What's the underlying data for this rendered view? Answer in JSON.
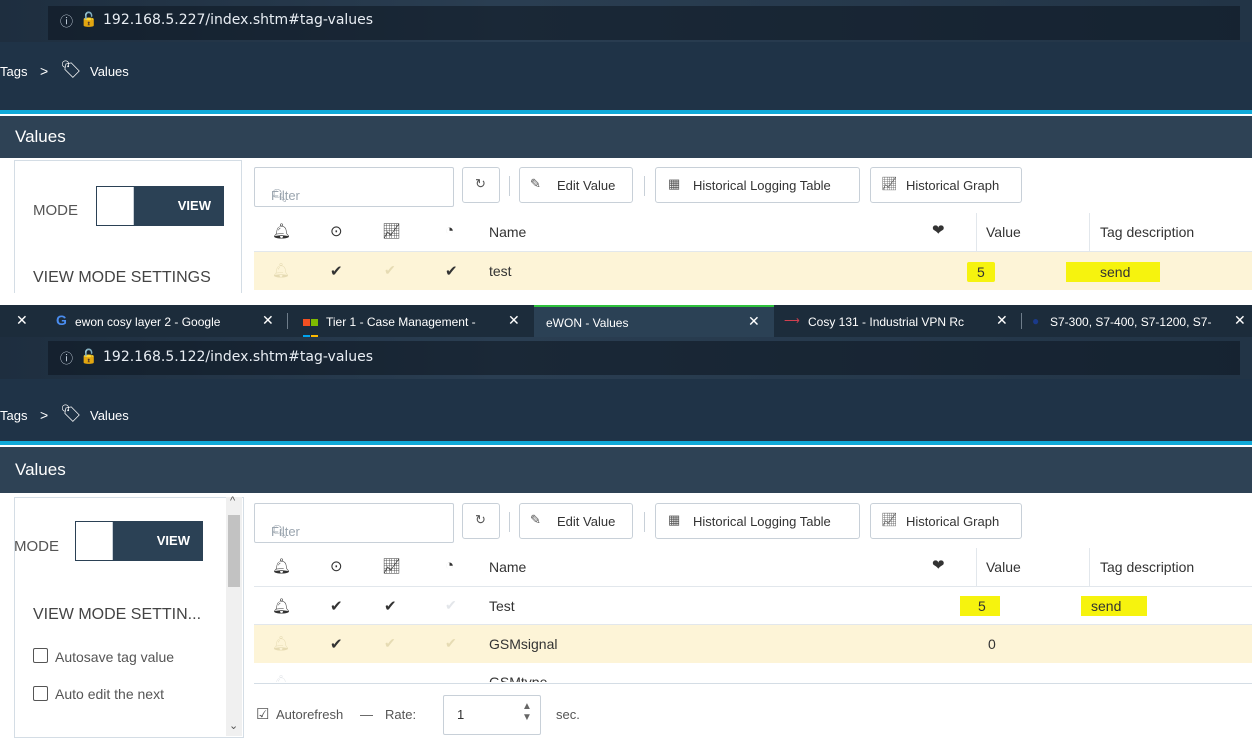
{
  "top": {
    "url": "192.168.5.227/index.shtm#tag-values",
    "breadcrumb": {
      "parent": "Tags",
      "separator": ">",
      "current": "Values"
    },
    "section_title": "Values",
    "mode_label": "MODE",
    "mode_toggle": "VIEW",
    "view_mode_settings": "VIEW MODE SETTINGS",
    "filter_placeholder": "Filter",
    "buttons": {
      "edit_value": "Edit Value",
      "historical_logging_table": "Historical Logging Table",
      "historical_graph": "Historical Graph"
    },
    "columns": {
      "name": "Name",
      "value": "Value",
      "tag_description": "Tag description"
    },
    "rows": [
      {
        "name": "test",
        "value": "5",
        "description": "send"
      }
    ]
  },
  "tabs": [
    {
      "label": "ewon cosy layer 2 - Google",
      "icon": "google-icon"
    },
    {
      "label": "Tier 1 - Case Management -",
      "icon": "windows-icon"
    },
    {
      "label": "eWON - Values",
      "icon": "none",
      "active": true
    },
    {
      "label": "Cosy 131 - Industrial VPN Rc",
      "icon": "ewon-icon"
    },
    {
      "label": "S7-300, S7-400, S7-1200, S7-",
      "icon": "siemens-icon"
    }
  ],
  "bottom": {
    "url": "192.168.5.122/index.shtm#tag-values",
    "breadcrumb": {
      "parent": "Tags",
      "separator": ">",
      "current": "Values"
    },
    "section_title": "Values",
    "mode_label": "MODE",
    "mode_toggle": "VIEW",
    "view_mode_settings": "VIEW MODE SETTIN...",
    "options": [
      "Autosave tag value",
      "Auto edit the next"
    ],
    "filter_placeholder": "Filter",
    "buttons": {
      "edit_value": "Edit Value",
      "historical_logging_table": "Historical Logging Table",
      "historical_graph": "Historical Graph"
    },
    "columns": {
      "name": "Name",
      "value": "Value",
      "tag_description": "Tag description"
    },
    "rows": [
      {
        "name": "Test",
        "value": "5",
        "description": "send"
      },
      {
        "name": "GSMsignal",
        "value": "0",
        "description": ""
      },
      {
        "name": "GSMtype",
        "value": "",
        "description": ""
      }
    ],
    "footer": {
      "autorefresh": "Autorefresh",
      "dash": "—",
      "rate_label": "Rate:",
      "rate_value": "1",
      "unit": "sec."
    }
  },
  "colors": {
    "header_bg": "#1f3347",
    "accent_cyan": "#10a9d8",
    "highlight_yellow": "#f6f30e",
    "row_highlight": "#fdf4d7",
    "active_tab_green": "#2ec13c"
  }
}
